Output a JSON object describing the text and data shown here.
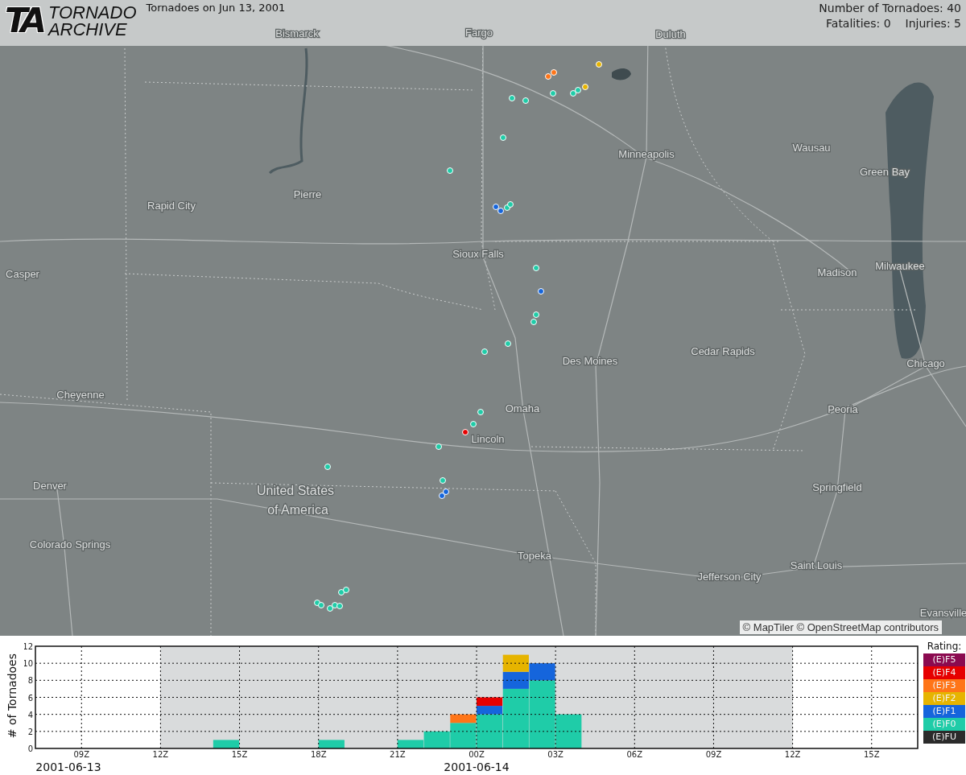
{
  "header": {
    "logo": {
      "mark": "TA",
      "line1": "TORNADO",
      "line2": "ARCHIVE"
    },
    "title": "Tornadoes on Jun 13, 2001",
    "stats": {
      "count": "Number of Tornadoes: 40",
      "fatalities": "Fatalities: 0",
      "injuries": "Injuries: 5"
    }
  },
  "map": {
    "labels": [
      {
        "kind": "city",
        "text": "Bismarck"
      },
      {
        "kind": "city",
        "text": "Fargo"
      },
      {
        "kind": "city",
        "text": "Duluth"
      },
      {
        "kind": "city",
        "text": "Minneapolis"
      },
      {
        "kind": "city",
        "text": "Wausau"
      },
      {
        "kind": "city",
        "text": "Green Bay"
      },
      {
        "kind": "city",
        "text": "Pierre"
      },
      {
        "kind": "city",
        "text": "Rapid City"
      },
      {
        "kind": "city",
        "text": "Casper"
      },
      {
        "kind": "city",
        "text": "Sioux Falls"
      },
      {
        "kind": "city",
        "text": "Madison"
      },
      {
        "kind": "city",
        "text": "Milwaukee"
      },
      {
        "kind": "city",
        "text": "Cheyenne"
      },
      {
        "kind": "city",
        "text": "Cedar Rapids"
      },
      {
        "kind": "city",
        "text": "Chicago"
      },
      {
        "kind": "city",
        "text": "Des Moines"
      },
      {
        "kind": "city",
        "text": "Omaha"
      },
      {
        "kind": "city",
        "text": "Lincoln"
      },
      {
        "kind": "city",
        "text": "Peoria"
      },
      {
        "kind": "city",
        "text": "Denver"
      },
      {
        "kind": "country",
        "text": "United States"
      },
      {
        "kind": "country",
        "text": "of America"
      },
      {
        "kind": "city",
        "text": "Springfield"
      },
      {
        "kind": "city",
        "text": "Colorado Springs"
      },
      {
        "kind": "city",
        "text": "Topeka"
      },
      {
        "kind": "city",
        "text": "Jefferson City"
      },
      {
        "kind": "city",
        "text": "Saint Louis"
      },
      {
        "kind": "city",
        "text": "Evansville"
      }
    ],
    "tornadoes": [
      {
        "color": "#ff7518"
      },
      {
        "color": "#ff7518"
      },
      {
        "color": "#e6b400"
      },
      {
        "color": "#e6b400"
      },
      {
        "color": "#1fcca8"
      },
      {
        "color": "#1fcca8"
      },
      {
        "color": "#1fcca8"
      },
      {
        "color": "#1fcca8"
      },
      {
        "color": "#1fcca8"
      },
      {
        "color": "#1fcca8"
      },
      {
        "color": "#1fcca8"
      },
      {
        "color": "#1565dc"
      },
      {
        "color": "#1565dc"
      },
      {
        "color": "#1fcca8"
      },
      {
        "color": "#1fcca8"
      },
      {
        "color": "#1fcca8"
      },
      {
        "color": "#1565dc"
      },
      {
        "color": "#1fcca8"
      },
      {
        "color": "#1fcca8"
      },
      {
        "color": "#1fcca8"
      },
      {
        "color": "#1fcca8"
      },
      {
        "color": "#1fcca8"
      },
      {
        "color": "#1fcca8"
      },
      {
        "color": "#e60000"
      },
      {
        "color": "#1fcca8"
      },
      {
        "color": "#1fcca8"
      },
      {
        "color": "#1fcca8"
      },
      {
        "color": "#1565dc"
      },
      {
        "color": "#1565dc"
      },
      {
        "color": "#1fcca8"
      },
      {
        "color": "#1fcca8"
      },
      {
        "color": "#1fcca8"
      },
      {
        "color": "#1fcca8"
      },
      {
        "color": "#1fcca8"
      },
      {
        "color": "#1fcca8"
      },
      {
        "color": "#1fcca8"
      }
    ],
    "attribution": "© MapTiler © OpenStreetMap contributors"
  },
  "chart": {
    "legend_title": "Rating:",
    "chart_data": {
      "type": "bar",
      "stacked": true,
      "ylabel": "# of Tornadoes",
      "x": [
        "2001-06-13T14:30",
        "2001-06-13T18:30",
        "2001-06-13T21:30",
        "2001-06-13T22:30",
        "2001-06-13T23:30",
        "2001-06-14T00:30",
        "2001-06-14T01:30",
        "2001-06-14T02:30",
        "2001-06-14T03:30"
      ],
      "series": [
        {
          "name": "(E)FU",
          "color": "#2b2b2b",
          "values": [
            0,
            0,
            0,
            0,
            0,
            0,
            0,
            0,
            0
          ]
        },
        {
          "name": "(E)F0",
          "color": "#1fcca8",
          "values": [
            1,
            1,
            1,
            2,
            3,
            4,
            7,
            8,
            4
          ]
        },
        {
          "name": "(E)F1",
          "color": "#1565dc",
          "values": [
            0,
            0,
            0,
            0,
            0,
            1,
            2,
            2,
            0
          ]
        },
        {
          "name": "(E)F2",
          "color": "#e6b400",
          "values": [
            0,
            0,
            0,
            0,
            0,
            0,
            2,
            0,
            0
          ]
        },
        {
          "name": "(E)F3",
          "color": "#ff7518",
          "values": [
            0,
            0,
            0,
            0,
            1,
            0,
            0,
            0,
            0
          ]
        },
        {
          "name": "(E)F4",
          "color": "#e60000",
          "values": [
            0,
            0,
            0,
            0,
            0,
            1,
            0,
            0,
            0
          ]
        },
        {
          "name": "(E)F5",
          "color": "#8b0a50",
          "values": [
            0,
            0,
            0,
            0,
            0,
            0,
            0,
            0,
            0
          ]
        }
      ],
      "xlim": [
        "2001-06-13T07:15",
        "2001-06-14T16:45"
      ],
      "ylim": [
        0,
        12
      ],
      "xticks": [
        {
          "value": "2001-06-13T09:00",
          "label": "09Z"
        },
        {
          "value": "2001-06-13T12:00",
          "label": "12Z"
        },
        {
          "value": "2001-06-13T15:00",
          "label": "15Z"
        },
        {
          "value": "2001-06-13T18:00",
          "label": "18Z"
        },
        {
          "value": "2001-06-13T21:00",
          "label": "21Z"
        },
        {
          "value": "2001-06-14T00:00",
          "label": "00Z"
        },
        {
          "value": "2001-06-14T03:00",
          "label": "03Z"
        },
        {
          "value": "2001-06-14T06:00",
          "label": "06Z"
        },
        {
          "value": "2001-06-14T09:00",
          "label": "09Z"
        },
        {
          "value": "2001-06-14T12:00",
          "label": "12Z"
        },
        {
          "value": "2001-06-14T15:00",
          "label": "15Z"
        }
      ],
      "yticks": [
        0,
        2,
        4,
        6,
        8,
        10,
        12
      ],
      "grid": true,
      "annotations": [
        "2001-06-13",
        "2001-06-14"
      ]
    }
  }
}
